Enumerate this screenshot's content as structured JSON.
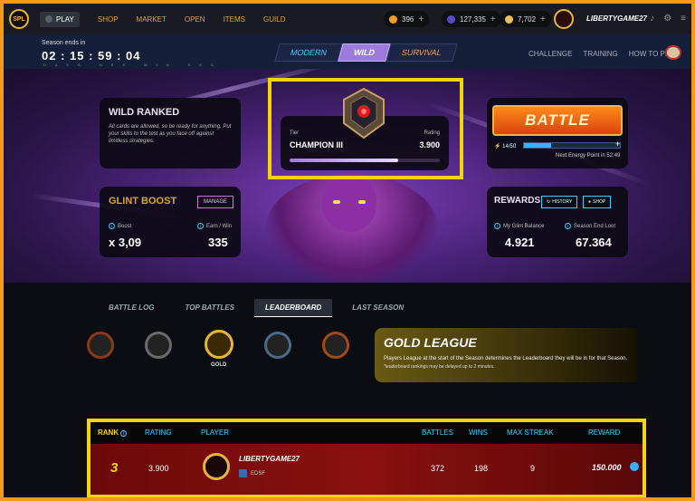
{
  "nav": {
    "play": "PLAY",
    "shop": "SHOP",
    "market": "MARKET",
    "open": "OPEN",
    "items": "ITEMS",
    "guild": "GUILD",
    "coins": "396",
    "credits": "127,335",
    "sps": "7,702",
    "username": "LIBERTYGAME27"
  },
  "season": {
    "label": "Season ends in",
    "timer": "02 : 15 : 59 : 04",
    "units": "DAYS HRS MIN SEC"
  },
  "modes": [
    "MODERN",
    "WILD",
    "SURVIVAL"
  ],
  "links": [
    "CHALLENGE",
    "TRAINING",
    "HOW TO PLAY"
  ],
  "wild": {
    "title": "WILD RANKED",
    "desc": "All cards are allowed, so be ready for anything. Put your skills to the test as you face off against limitless strategies."
  },
  "glint": {
    "title": "GLINT BOOST",
    "manage": "MANAGE",
    "boost_label": "Boost",
    "boost_value": "x 3,09",
    "earn_label": "Earn / Win",
    "earn_value": "335"
  },
  "tier": {
    "tier_label": "Tier",
    "tier_value": "CHAMPION III",
    "rating_label": "Rating",
    "rating_value": "3.900",
    "progress": 0.72
  },
  "battle": {
    "label": "BATTLE",
    "energy": "14/50",
    "energy_fraction": 0.28,
    "next": "Next Energy Point in 52:49"
  },
  "rewards": {
    "title": "REWARDS",
    "history": "HISTORY",
    "shop": "SHOP",
    "balance_label": "My Glint Balance",
    "balance_value": "4.921",
    "loot_label": "Season End Loot",
    "loot_value": "67.364"
  },
  "tabs": [
    "BATTLE LOG",
    "TOP BATTLES",
    "LEADERBOARD",
    "LAST SEASON"
  ],
  "league": {
    "gold_label": "GOLD",
    "title": "GOLD LEAGUE",
    "desc": "Players League at the start of the Season determines the Leaderboard they will be in for that Season.",
    "note": "*leaderboard rankings may be delayed up to 2 minutes."
  },
  "leaderboard": {
    "headers": [
      "RANK",
      "RATING",
      "PLAYER",
      "BATTLES",
      "WINS",
      "MAX STREAK",
      "REWARD"
    ],
    "row": {
      "rank": "3",
      "rating": "3.900",
      "player": "LIBERTYGAME27",
      "guild": "EDSF",
      "battles": "372",
      "wins": "198",
      "max_streak": "9",
      "reward": "150.000"
    }
  }
}
